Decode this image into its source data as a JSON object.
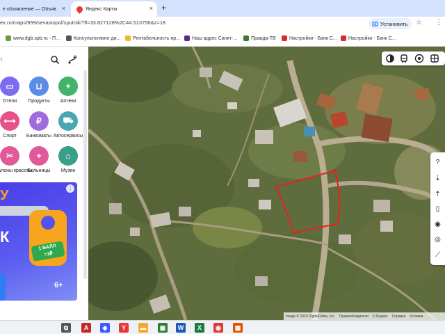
{
  "browser": {
    "tabs": [
      {
        "title": "е объявление — Объяв"
      },
      {
        "title": "Яндекс Карты"
      }
    ],
    "new_tab_symbol": "+",
    "close_symbol": "×",
    "url": "ex.ru/maps/959/sevastopol/sputnik/?ll=33.827128%2C44.513756&z=18",
    "install_label": "Установить",
    "bookmarks": [
      {
        "label": "www.dgb.spb.ru - П...",
        "color": "#6a9f3a"
      },
      {
        "label": "Консультативно-ди...",
        "color": "#555555"
      },
      {
        "label": "Рентабельность пр...",
        "color": "#e9b93a"
      },
      {
        "label": "Наш адрес Санкт-...",
        "color": "#5a2a8a"
      },
      {
        "label": "Правда-ТВ",
        "color": "#3a7a2a"
      },
      {
        "label": "Настройки - Банк С...",
        "color": "#d03030"
      },
      {
        "label": "Настройки - Банк С...",
        "color": "#d03030"
      }
    ]
  },
  "panel": {
    "search_placeholder": "т",
    "categories": [
      {
        "label": "Отели",
        "color": "#7b6cf2",
        "icon": "bed-icon"
      },
      {
        "label": "Продукты",
        "color": "#5b8de8",
        "icon": "basket-icon"
      },
      {
        "label": "Аптеки",
        "color": "#43b36a",
        "icon": "plus-icon"
      },
      {
        "label": "Спорт",
        "color": "#e8508a",
        "icon": "dumbbell-icon"
      },
      {
        "label": "Банкоматы",
        "color": "#a16be0",
        "icon": "ruble-icon"
      },
      {
        "label": "Автосервисы",
        "color": "#4aa6b0",
        "icon": "car-icon"
      },
      {
        "label": "Салоны красоты",
        "color": "#e05a9a",
        "icon": "scissors-icon"
      },
      {
        "label": "Больницы",
        "color": "#e05a9a",
        "icon": "plus-icon"
      },
      {
        "label": "Музеи",
        "color": "#3a9f8a",
        "icon": "museum-icon"
      }
    ],
    "ad": {
      "letter": "К",
      "badge_line1": "1 БАЛЛ",
      "badge_line2": "=1₽",
      "age": "6+",
      "more": "⋮"
    }
  },
  "map": {
    "copyright_image": "Image © 2020 DigitalGlobe, Inc.",
    "copyright_legal": "Правообладатели",
    "copyright_yandex": "© Яндекс",
    "help": "Справка",
    "terms": "Условия"
  },
  "taskbar": {
    "items": [
      {
        "name": "task-view-icon",
        "color": "#555555",
        "glyph": "⧉"
      },
      {
        "name": "pdf-icon",
        "color": "#c62828",
        "glyph": "A"
      },
      {
        "name": "app-icon",
        "color": "#3d5afe",
        "glyph": "◆"
      },
      {
        "name": "yandex-browser-icon",
        "color": "#e53935",
        "glyph": "Y"
      },
      {
        "name": "folder-icon",
        "color": "#f9a825",
        "glyph": "▬"
      },
      {
        "name": "image-viewer-icon",
        "color": "#2e7d32",
        "glyph": "▣"
      },
      {
        "name": "word-icon",
        "color": "#1e5bb8",
        "glyph": "W"
      },
      {
        "name": "excel-icon",
        "color": "#1d7a3e",
        "glyph": "X"
      },
      {
        "name": "chrome-icon",
        "color": "#e53935",
        "glyph": "◉"
      },
      {
        "name": "mosaic-app-icon",
        "color": "#e65100",
        "glyph": "▦"
      }
    ]
  }
}
